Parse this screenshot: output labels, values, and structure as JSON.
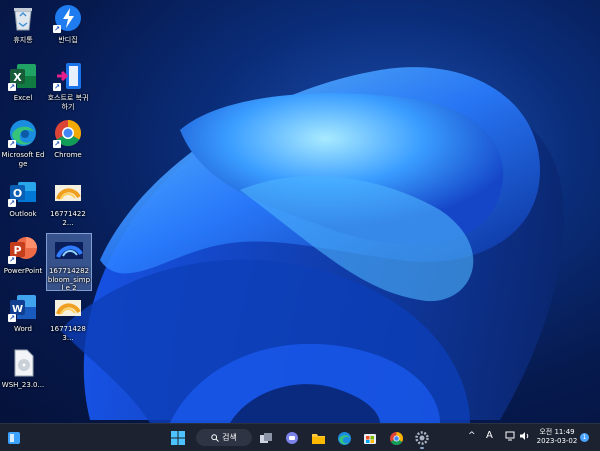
{
  "desktop": {
    "icons": [
      {
        "label": "휴지통",
        "icon": "recycle-bin-icon"
      },
      {
        "label": "반디집",
        "icon": "bandizip-icon"
      },
      {
        "label": "Excel",
        "icon": "excel-icon"
      },
      {
        "label": "호스트로 복귀하기",
        "icon": "return-to-host-icon"
      },
      {
        "label": "Microsoft Edge",
        "icon": "edge-icon"
      },
      {
        "label": "Chrome",
        "icon": "chrome-icon"
      },
      {
        "label": "Outlook",
        "icon": "outlook-icon"
      },
      {
        "label": "167714222...",
        "icon": "image-thumbnail-icon"
      },
      {
        "label": "PowerPoint",
        "icon": "powerpoint-icon"
      },
      {
        "label": "167714282 bloom_simpl e 2",
        "icon": "image-thumbnail-icon"
      },
      {
        "label": "Word",
        "icon": "word-icon"
      },
      {
        "label": "167714283...",
        "icon": "image-thumbnail-icon"
      },
      {
        "label": "WSH_23.0...",
        "icon": "disc-file-icon"
      }
    ]
  },
  "taskbar": {
    "search_label": "검색",
    "pinned": [
      "start-icon",
      "search-icon",
      "task-view-icon",
      "teams-chat-icon",
      "file-explorer-icon",
      "edge-icon",
      "store-icon",
      "chrome-icon",
      "settings-icon"
    ],
    "tray": {
      "chevron": "^",
      "ime": "A"
    },
    "clock": {
      "period_time": "오전 11:49",
      "date": "2023-03-02"
    },
    "notification_count": "1"
  }
}
